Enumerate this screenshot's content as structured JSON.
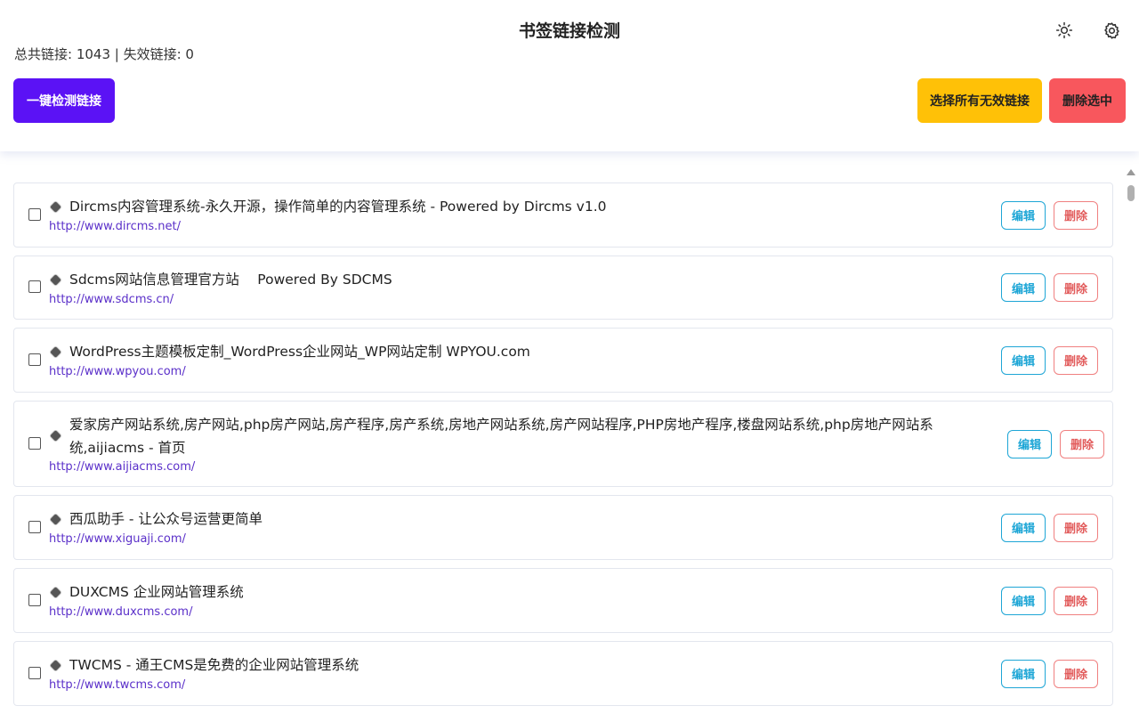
{
  "header": {
    "title": "书签链接检测",
    "stats": "总共链接: 1043 | 失效链接: 0",
    "theme_icon": "sun-icon",
    "settings_icon": "gear-icon"
  },
  "toolbar": {
    "check_label": "一键检测链接",
    "select_invalid_label": "选择所有无效链接",
    "delete_selected_label": "删除选中"
  },
  "colors": {
    "primary": "#5b12f5",
    "warning": "#ffc107",
    "danger": "#f8575d",
    "edit": "#1ea6d6",
    "link": "#5a2fc9"
  },
  "list": {
    "edit_label": "编辑",
    "delete_label": "删除",
    "items": [
      {
        "name": "Dircms内容管理系统-永久开源，操作简单的内容管理系统 - Powered by Dircms v1.0",
        "url": "http://www.dircms.net/"
      },
      {
        "name": "Sdcms网站信息管理官方站　 Powered By SDCMS",
        "url": "http://www.sdcms.cn/"
      },
      {
        "name": "WordPress主题模板定制_WordPress企业网站_WP网站定制 WPYOU.com",
        "url": "http://www.wpyou.com/"
      },
      {
        "name_line1": "爱家房产网站系统,房产网站,php房产网站,房产程序,房产系统,房地产网站系统,房产网站程序,PHP房地产程序,楼盘网站系统,php房地产网站系",
        "name_line2": "统,aijiacms - 首页",
        "url": "http://www.aijiacms.com/"
      },
      {
        "name": "西瓜助手 - 让公众号运营更简单",
        "url": "http://www.xiguaji.com/"
      },
      {
        "name": "DUXCMS 企业网站管理系统",
        "url": "http://www.duxcms.com/"
      },
      {
        "name": "TWCMS - 通王CMS是免费的企业网站管理系统",
        "url": "http://www.twcms.com/"
      }
    ]
  }
}
